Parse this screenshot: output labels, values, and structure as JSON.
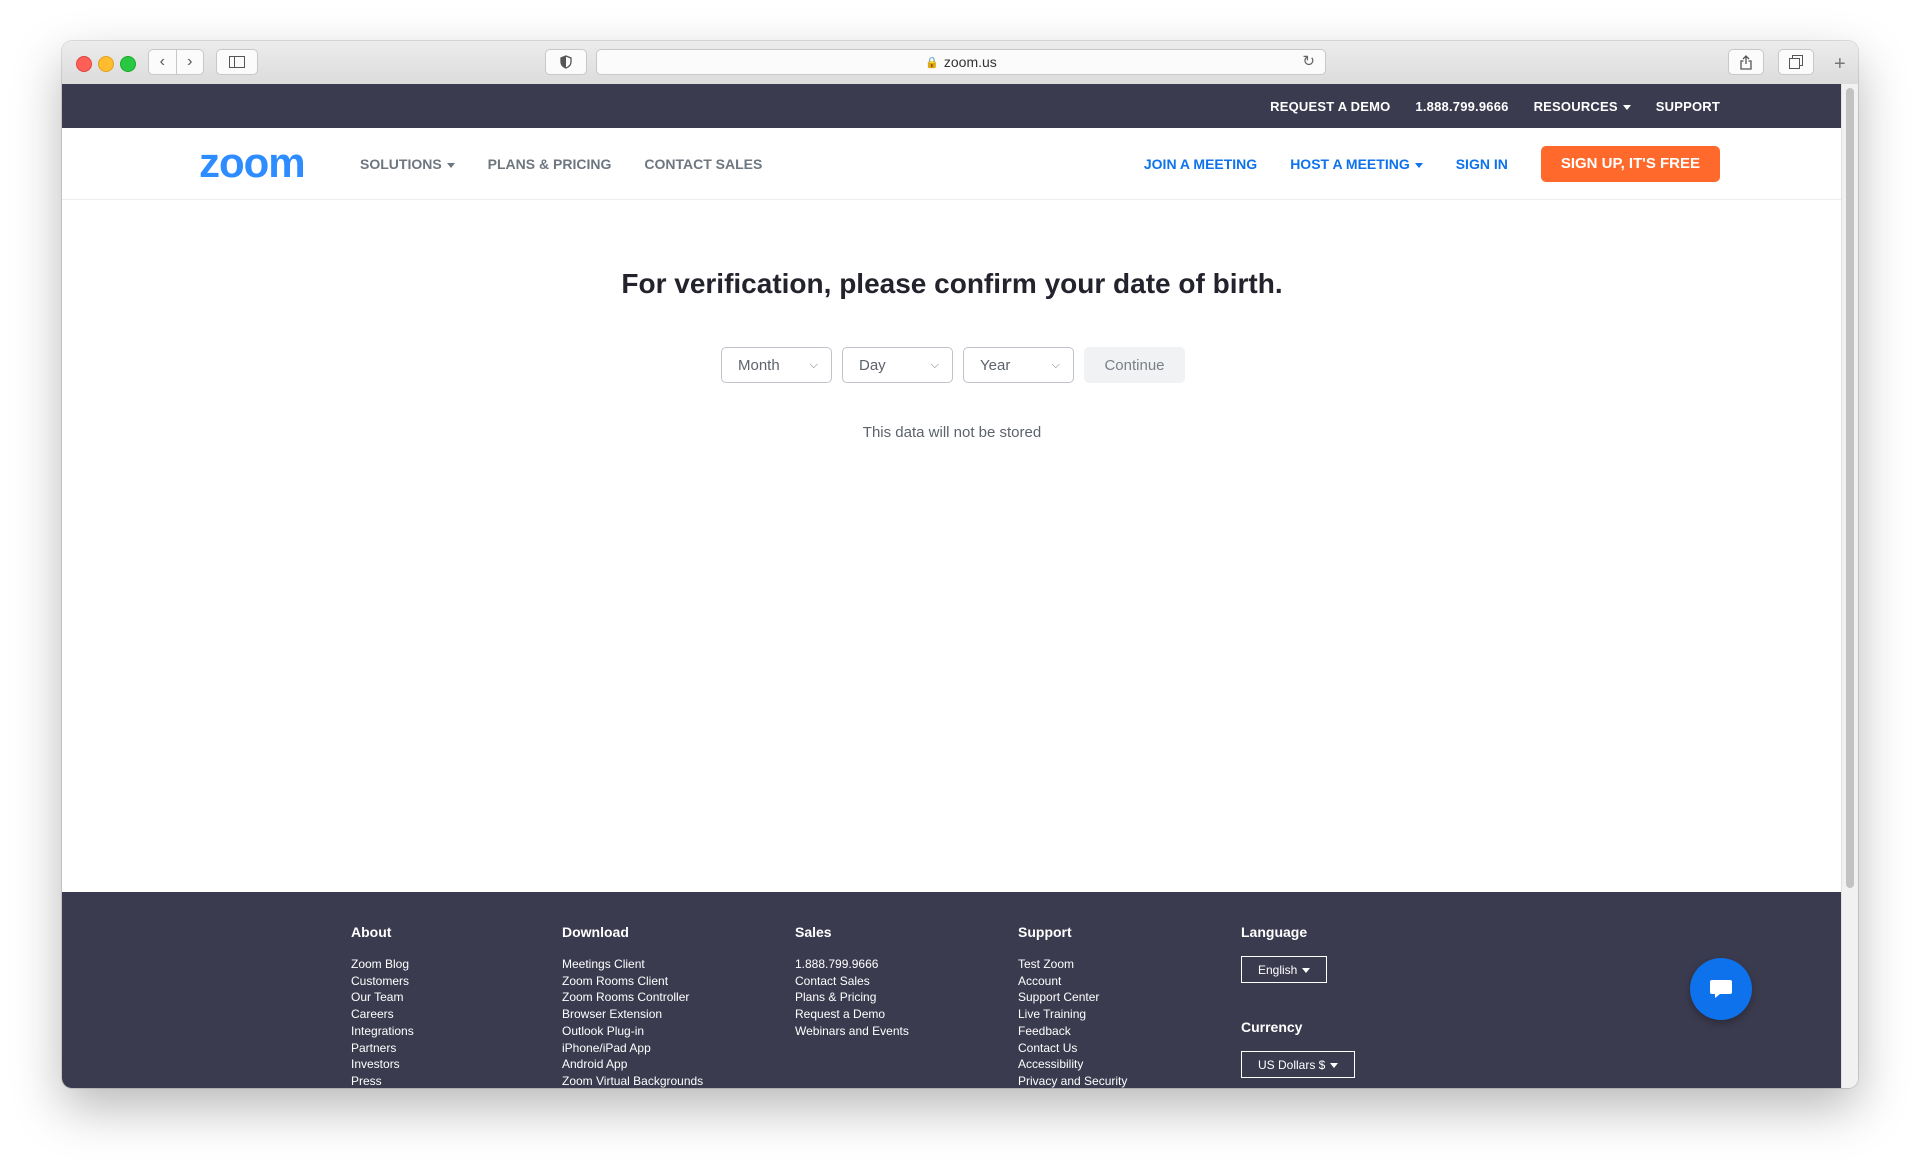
{
  "browser": {
    "url": "zoom.us",
    "back_glyph": "‹",
    "forward_glyph": "›",
    "new_tab_glyph": "+"
  },
  "topbar": {
    "request_demo": "REQUEST A DEMO",
    "phone": "1.888.799.9666",
    "resources": "RESOURCES",
    "support": "SUPPORT"
  },
  "nav": {
    "logo": "zoom",
    "solutions": "SOLUTIONS",
    "plans": "PLANS & PRICING",
    "contact_sales": "CONTACT SALES",
    "join": "JOIN A MEETING",
    "host": "HOST A MEETING",
    "sign_in": "SIGN IN",
    "sign_up": "SIGN UP, IT'S FREE"
  },
  "verification": {
    "headline": "For verification, please confirm your date of birth.",
    "month": "Month",
    "day": "Day",
    "year": "Year",
    "continue": "Continue",
    "note": "This data will not be stored"
  },
  "footer": {
    "about": {
      "title": "About",
      "items": [
        "Zoom Blog",
        "Customers",
        "Our Team",
        "Careers",
        "Integrations",
        "Partners",
        "Investors",
        "Press"
      ]
    },
    "download": {
      "title": "Download",
      "items": [
        "Meetings Client",
        "Zoom Rooms Client",
        "Zoom Rooms Controller",
        "Browser Extension",
        "Outlook Plug-in",
        "iPhone/iPad App",
        "Android App",
        "Zoom Virtual Backgrounds"
      ]
    },
    "sales": {
      "title": "Sales",
      "items": [
        "1.888.799.9666",
        "Contact Sales",
        "Plans & Pricing",
        "Request a Demo",
        "Webinars and Events"
      ]
    },
    "support": {
      "title": "Support",
      "items": [
        "Test Zoom",
        "Account",
        "Support Center",
        "Live Training",
        "Feedback",
        "Contact Us",
        "Accessibility",
        "Privacy and Security"
      ]
    },
    "language": {
      "title": "Language",
      "value": "English"
    },
    "currency": {
      "title": "Currency",
      "value": "US Dollars $"
    }
  },
  "colors": {
    "brand_blue": "#2d8cff",
    "link_blue": "#0e72ed",
    "signup_orange": "#ff6a2c",
    "dark_bar": "#3b3b4f"
  }
}
